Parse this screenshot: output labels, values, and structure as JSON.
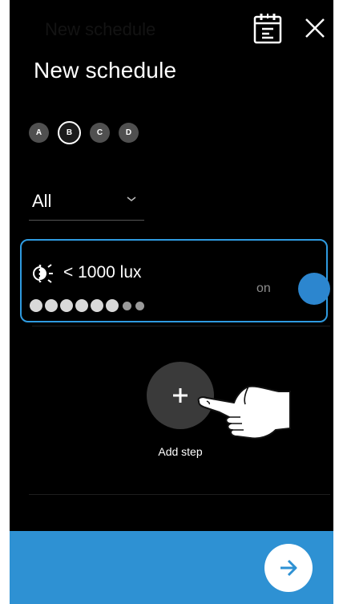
{
  "header": {
    "ghost_title": "New schedule",
    "title": "New schedule"
  },
  "channels": [
    {
      "label": "A",
      "selected": false
    },
    {
      "label": "B",
      "selected": true
    },
    {
      "label": "C",
      "selected": false
    },
    {
      "label": "D",
      "selected": false
    }
  ],
  "day_filter": {
    "value": "All"
  },
  "step": {
    "condition": "< 1000 lux",
    "state": "on",
    "dots_large": 6,
    "dots_small": 2
  },
  "add_step": {
    "label": "Add step"
  },
  "colors": {
    "accent": "#2e91d3",
    "card_border": "#2f9be0",
    "toggle": "#2c86cf",
    "add_button": "#3a3a3a"
  },
  "icons": {
    "calendar": "calendar-icon",
    "close": "close-icon",
    "light": "light-sensor-icon",
    "plus": "plus-icon",
    "hand": "pointing-hand-icon",
    "next": "arrow-right-icon"
  }
}
